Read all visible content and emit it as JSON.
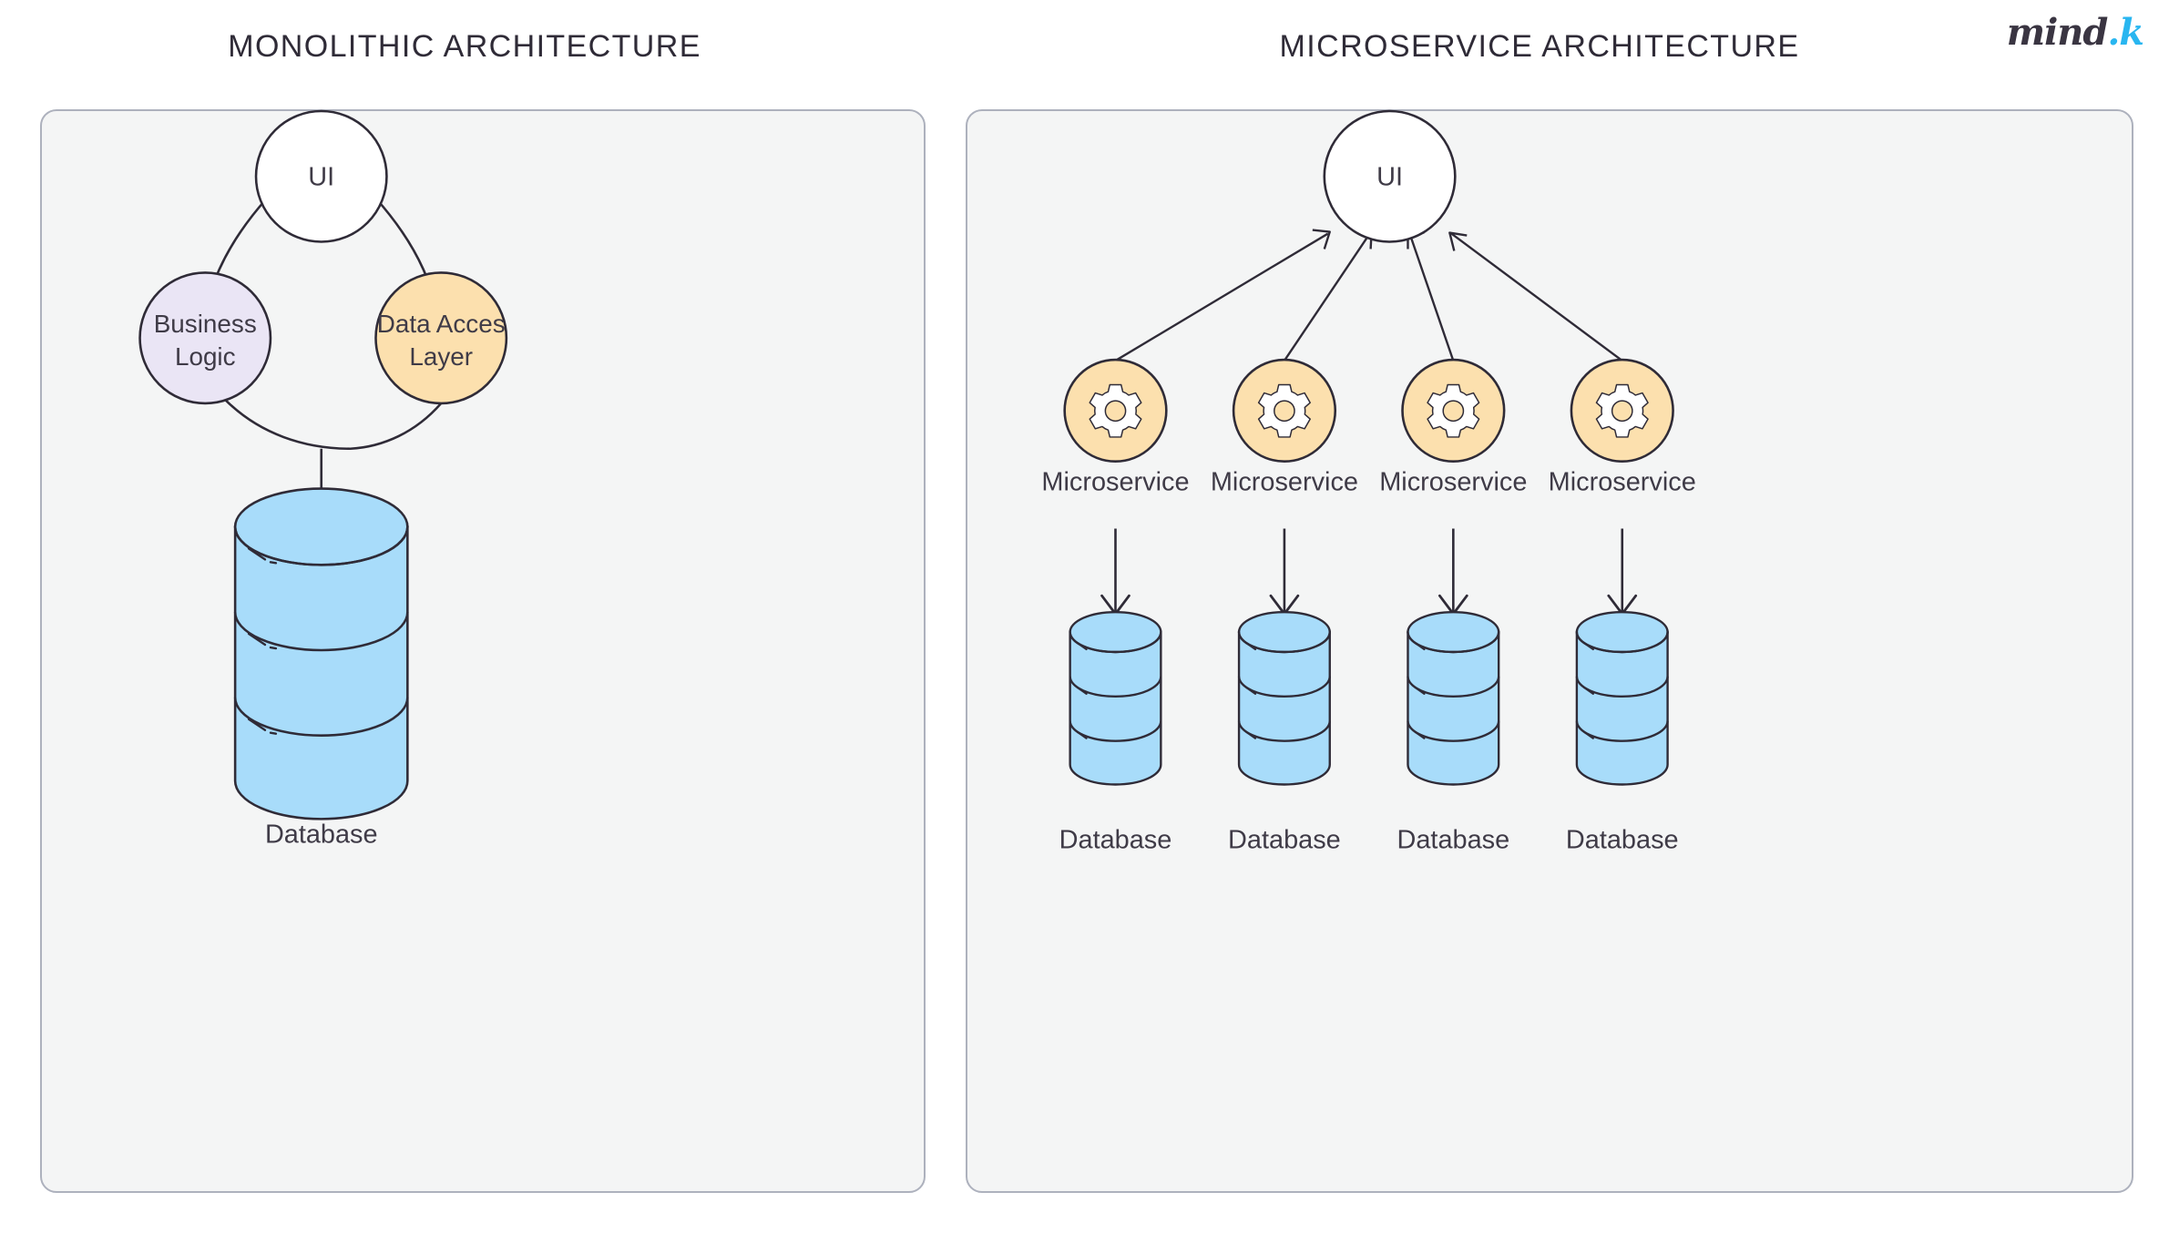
{
  "brand": {
    "name": "mind",
    "suffix": ".k",
    "accent_color": "#29b6f0",
    "text_color": "#3a3542"
  },
  "palette": {
    "page_background": "#ffffff",
    "panel_background": "#f4f5f5",
    "panel_border": "#adb1bd",
    "stroke": "#2f2b37",
    "text": "#3f3b47",
    "ui_circle_fill": "#ffffff",
    "business_logic_fill": "#eae5f5",
    "data_access_fill": "#fce0ae",
    "microservice_fill": "#fce0ae",
    "database_fill": "#a8dcfa"
  },
  "monolith": {
    "title": "MONOLITHIC ARCHITECTURE",
    "nodes": {
      "ui": {
        "label": "UI"
      },
      "business_logic": {
        "line1": "Business",
        "line2": "Logic"
      },
      "data_access": {
        "line1": "Data Acces",
        "line2": "Layer"
      },
      "database": {
        "caption": "Database"
      }
    }
  },
  "microservice": {
    "title": "MICROSERVICE ARCHITECTURE",
    "nodes": {
      "ui": {
        "label": "UI"
      }
    },
    "services": [
      {
        "label": "Microservice",
        "icon": "gear-icon",
        "database_caption": "Database"
      },
      {
        "label": "Microservice",
        "icon": "gear-icon",
        "database_caption": "Database"
      },
      {
        "label": "Microservice",
        "icon": "gear-icon",
        "database_caption": "Database"
      },
      {
        "label": "Microservice",
        "icon": "gear-icon",
        "database_caption": "Database"
      }
    ]
  },
  "chart_data": {
    "type": "diagram",
    "title": "Monolithic vs Microservice Architecture",
    "panels": [
      {
        "title": "MONOLITHIC ARCHITECTURE",
        "nodes": [
          "UI",
          "Business Logic",
          "Data Acces Layer",
          "Database"
        ],
        "edges": [
          {
            "from": "UI",
            "to": "Business Logic",
            "style": "arc",
            "arrow": false
          },
          {
            "from": "UI",
            "to": "Data Acces Layer",
            "style": "arc",
            "arrow": false
          },
          {
            "from": "Business Logic",
            "to": "Data Acces Layer",
            "style": "arc",
            "arrow": false
          },
          {
            "from": "Data Acces Layer",
            "to": "Database",
            "style": "straight",
            "arrow": "down"
          }
        ]
      },
      {
        "title": "MICROSERVICE ARCHITECTURE",
        "nodes": [
          "UI",
          "Microservice",
          "Microservice",
          "Microservice",
          "Microservice",
          "Database",
          "Database",
          "Database",
          "Database"
        ],
        "edges": [
          {
            "from": "Microservice 1",
            "to": "UI",
            "style": "straight",
            "arrow": "up"
          },
          {
            "from": "Microservice 2",
            "to": "UI",
            "style": "straight",
            "arrow": "up"
          },
          {
            "from": "Microservice 3",
            "to": "UI",
            "style": "straight",
            "arrow": "up"
          },
          {
            "from": "Microservice 4",
            "to": "UI",
            "style": "straight",
            "arrow": "up"
          },
          {
            "from": "Microservice 1",
            "to": "Database 1",
            "style": "straight",
            "arrow": "down"
          },
          {
            "from": "Microservice 2",
            "to": "Database 2",
            "style": "straight",
            "arrow": "down"
          },
          {
            "from": "Microservice 3",
            "to": "Database 3",
            "style": "straight",
            "arrow": "down"
          },
          {
            "from": "Microservice 4",
            "to": "Database 4",
            "style": "straight",
            "arrow": "down"
          }
        ]
      }
    ]
  }
}
